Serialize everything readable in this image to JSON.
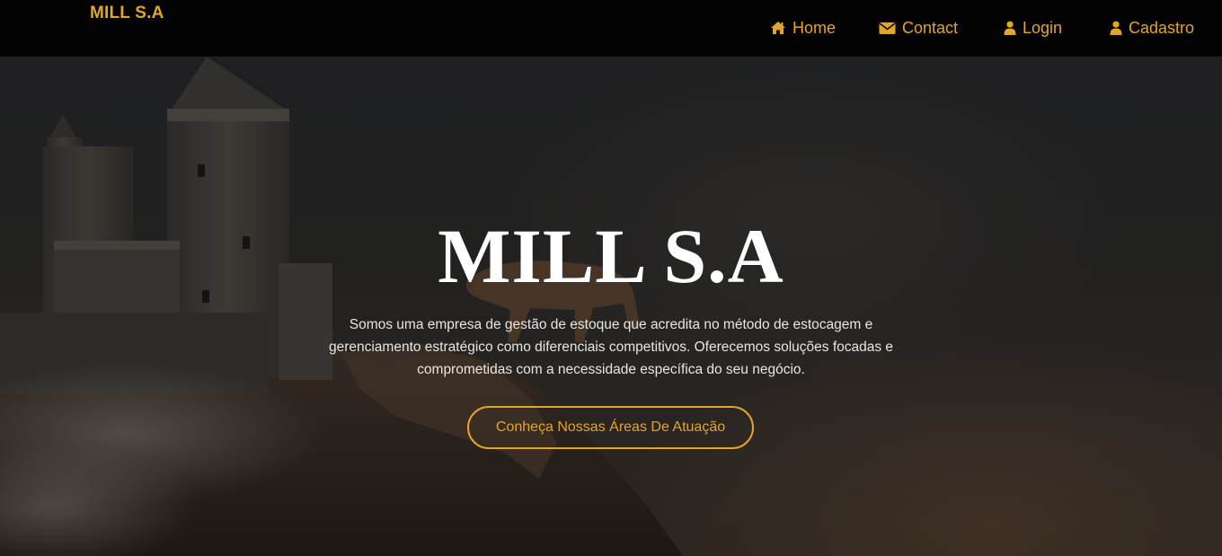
{
  "colors": {
    "accent": "#e3a42a",
    "navbar_bg": "#030303",
    "hero_text": "#ffffff"
  },
  "navbar": {
    "brand": "MILL S.A",
    "links": [
      {
        "label": "Home",
        "icon": "home-icon"
      },
      {
        "label": "Contact",
        "icon": "envelope-icon"
      },
      {
        "label": "Login",
        "icon": "user-icon"
      },
      {
        "label": "Cadastro",
        "icon": "user-icon"
      }
    ]
  },
  "hero": {
    "title": "MILL S.A",
    "lines": [
      "Somos uma empresa de gestão de estoque que acredita no método de estocagem e",
      "gerenciamento estratégico como diferenciais competitivos. Oferecemos soluções focadas e",
      "comprometidas com a necessidade específica do seu negócio."
    ],
    "button_label": "Conheça Nossas Áreas De Atuação"
  }
}
